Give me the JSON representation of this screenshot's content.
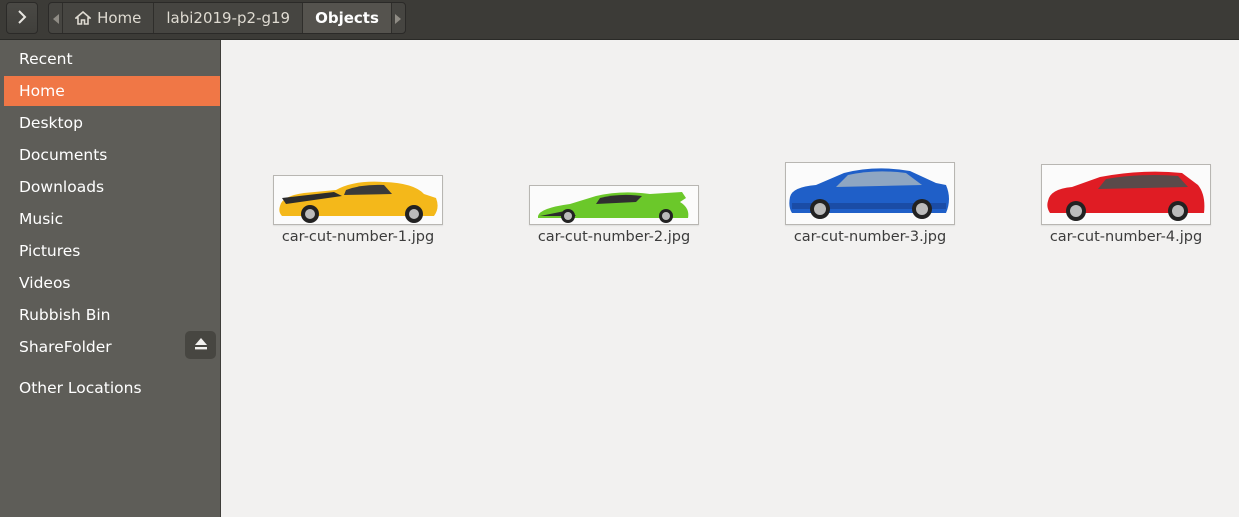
{
  "header": {
    "breadcrumbs": [
      {
        "label": "Home",
        "icon": "home-icon"
      },
      {
        "label": "labi2019-p2-g19"
      },
      {
        "label": "Objects",
        "active": true
      }
    ]
  },
  "sidebar": {
    "items": [
      {
        "label": "Recent"
      },
      {
        "label": "Home",
        "selected": true
      },
      {
        "label": "Desktop"
      },
      {
        "label": "Documents"
      },
      {
        "label": "Downloads"
      },
      {
        "label": "Music"
      },
      {
        "label": "Pictures"
      },
      {
        "label": "Videos"
      },
      {
        "label": "Rubbish Bin"
      },
      {
        "label": "ShareFolder",
        "icon": "eject-icon"
      },
      {
        "label": "Other Locations"
      }
    ]
  },
  "files": [
    {
      "name": "car-cut-number-1.jpg",
      "color": "#f4b81a"
    },
    {
      "name": "car-cut-number-2.jpg",
      "color": "#6bc82a"
    },
    {
      "name": "car-cut-number-3.jpg",
      "color": "#1f5fc8"
    },
    {
      "name": "car-cut-number-4.jpg",
      "color": "#e01c24"
    }
  ],
  "colors": {
    "accent": "#f07746",
    "sidebar": "#5e5d58",
    "headerbar": "#3c3b37"
  }
}
